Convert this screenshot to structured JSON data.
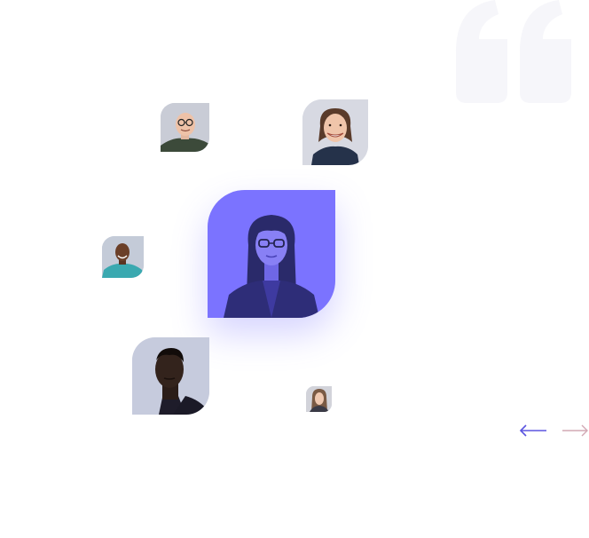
{
  "colors": {
    "accent": "#6c63ff",
    "accent_dark": "#3b3a8f",
    "quote_mark": "#f6f6fa",
    "arrow_prev": "#5b55e0",
    "arrow_next": "#d2a8b4"
  },
  "quote_icon": "quote-icon",
  "testimonials": {
    "avatars": [
      {
        "name": "avatar-man-glasses"
      },
      {
        "name": "avatar-woman-smiling"
      },
      {
        "name": "avatar-man-teal-shirt"
      },
      {
        "name": "avatar-woman-glasses-selected"
      },
      {
        "name": "avatar-man-portrait"
      },
      {
        "name": "avatar-woman-small"
      }
    ],
    "active_index": 3
  },
  "navigation": {
    "prev_icon": "arrow-left-icon",
    "next_icon": "arrow-right-icon"
  }
}
